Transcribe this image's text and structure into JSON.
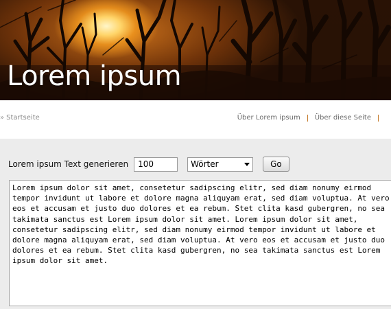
{
  "header": {
    "title": "Lorem ipsum"
  },
  "nav": {
    "home": "Startseite",
    "links": [
      "Über Lorem ipsum",
      "Über diese Seite"
    ]
  },
  "generator": {
    "label": "Lorem ipsum Text generieren",
    "count_value": "100",
    "unit_selected": "Wörter",
    "go_label": "Go",
    "output_text": "Lorem ipsum dolor sit amet, consetetur sadipscing elitr, sed diam nonumy eirmod tempor invidunt ut labore et dolore magna aliquyam erat, sed diam voluptua. At vero eos et accusam et justo duo dolores et ea rebum. Stet clita kasd gubergren, no sea takimata sanctus est Lorem ipsum dolor sit amet. Lorem ipsum dolor sit amet, consetetur sadipscing elitr, sed diam nonumy eirmod tempor invidunt ut labore et dolore magna aliquyam erat, sed diam voluptua. At vero eos et accusam et justo duo dolores et ea rebum. Stet clita kasd gubergren, no sea takimata sanctus est Lorem ipsum dolor sit amet."
  },
  "colors": {
    "nav_separator": "#c47a2a",
    "main_background": "#ececec"
  }
}
